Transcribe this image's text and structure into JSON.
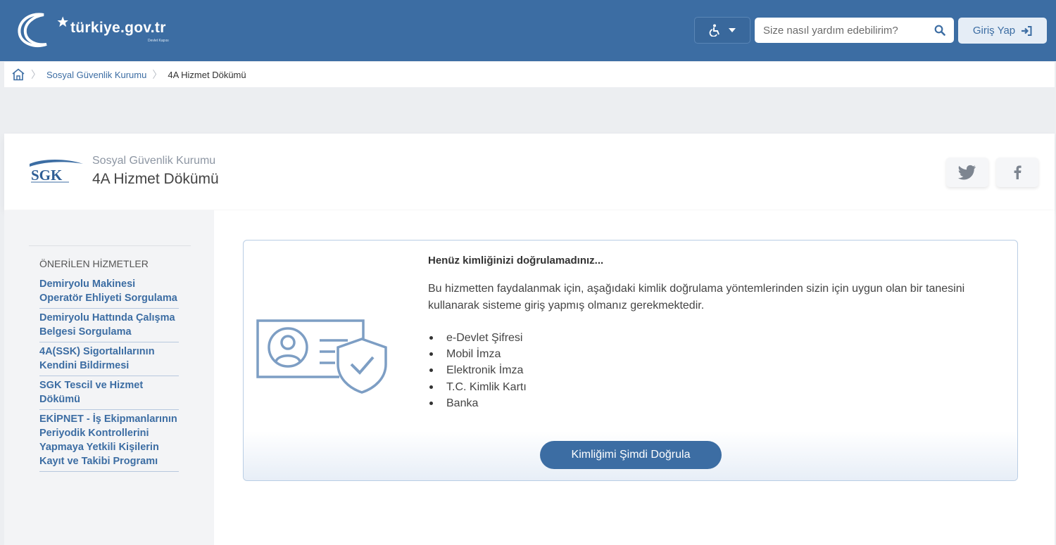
{
  "header": {
    "logo_text": "türkiye.gov.tr",
    "logo_subtext": "Devlet Kapısı",
    "search_placeholder": "Size nasıl yardım edebilirim?",
    "login_label": "Giriş Yap",
    "accessibility_icon": "wheelchair-icon",
    "colors": {
      "primary": "#3c6da3",
      "login_bg": "#e5edf6"
    }
  },
  "breadcrumb": {
    "home_icon": "home-icon",
    "items": [
      "Sosyal Güvenlik Kurumu",
      "4A Hizmet Dökümü"
    ]
  },
  "page_header": {
    "logo_text": "SGK",
    "agency": "Sosyal Güvenlik Kurumu",
    "title": "4A Hizmet Dökümü",
    "share": [
      "twitter-icon",
      "facebook-icon"
    ]
  },
  "sidebar": {
    "heading": "ÖNERİLEN HİZMETLER",
    "items": [
      "Demiryolu Makinesi Operatör Ehliyeti Sorgulama",
      "Demiryolu Hattında Çalışma Belgesi Sorgulama",
      "4A(SSK) Sigortalılarının Kendini Bildirmesi",
      "SGK Tescil ve Hizmet Dökümü",
      "EKİPNET - İş Ekipmanlarının Periyodik Kontrollerini Yapmaya Yetkili Kişilerin Kayıt ve Takibi Programı"
    ]
  },
  "auth": {
    "title": "Henüz kimliğinizi doğrulamadınız...",
    "description": "Bu hizmetten faydalanmak için, aşağıdaki kimlik doğrulama yöntemlerinden sizin için uygun olan bir tanesini kullanarak sisteme giriş yapmış olmanız gerekmektedir.",
    "methods": [
      "e-Devlet Şifresi",
      "Mobil İmza",
      "Elektronik İmza",
      "T.C. Kimlik Kartı",
      "Banka"
    ],
    "button_label": "Kimliğimi Şimdi Doğrula",
    "illustration": "id-card-shield-icon"
  }
}
